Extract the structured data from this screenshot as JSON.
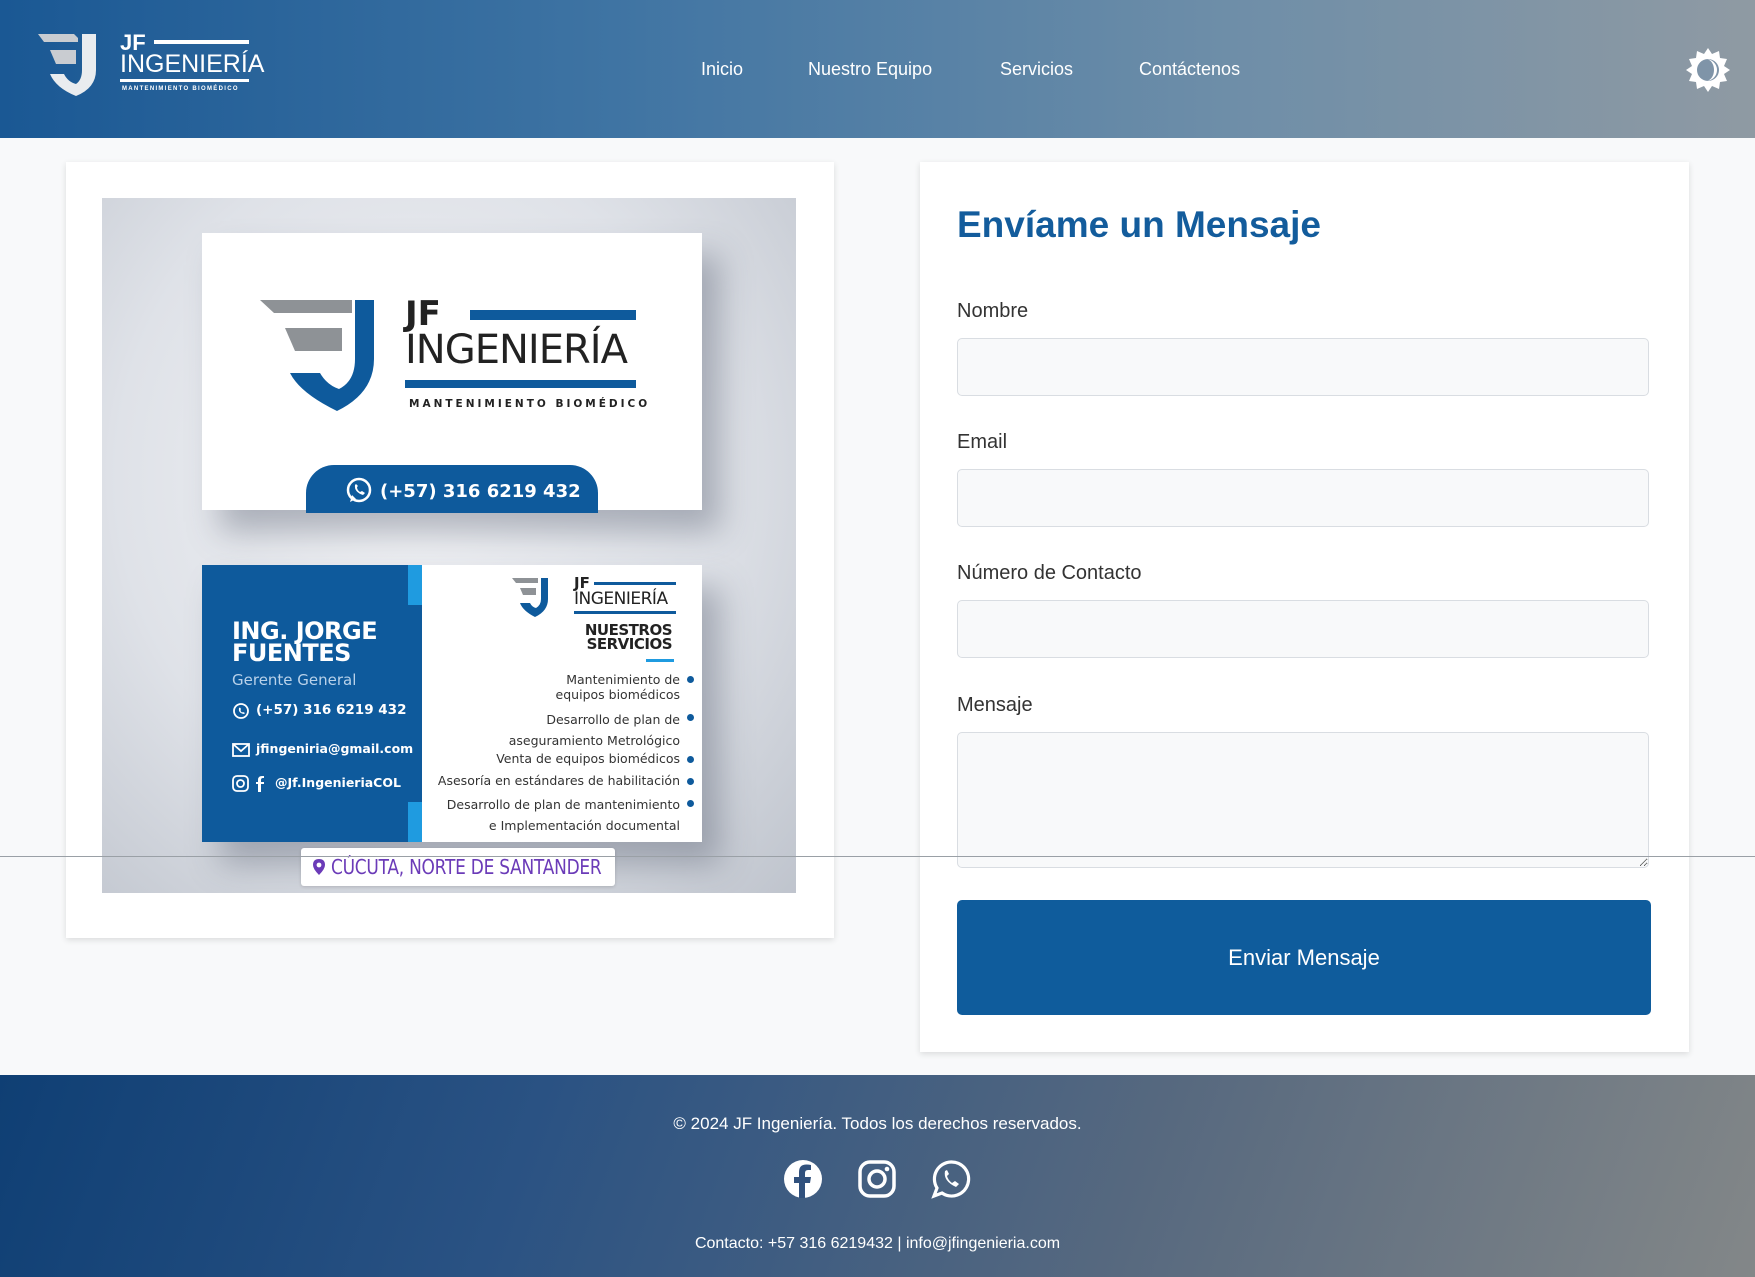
{
  "header": {
    "logo": {
      "jf": "JF",
      "name": "INGENIERÍA",
      "tagline": "MANTENIMIENTO BIOMÉDICO"
    },
    "nav": [
      {
        "label": "Inicio"
      },
      {
        "label": "Nuestro Equipo"
      },
      {
        "label": "Servicios"
      },
      {
        "label": "Contáctenos"
      }
    ],
    "theme_toggle_icon": "sun-moon-icon"
  },
  "business_card_image": {
    "front": {
      "jf": "JF",
      "name": "INGENIERÍA",
      "tagline": "MANTENIMIENTO BIOMÉDICO",
      "phone": "(+57) 316 6219 432"
    },
    "back": {
      "person_name": "ING. JORGE\nFUENTES",
      "role": "Gerente General",
      "phone": "(+57) 316 6219 432",
      "email": "jfingeniria@gmail.com",
      "social": "@Jf.IngenieriaCOL",
      "logo_jf": "JF",
      "logo_name": "INGENIERÍA",
      "services_title": "NUESTROS\nSERVICIOS",
      "services": [
        "Mantenimiento de\nequipos biomédicos",
        "Desarrollo de plan de\naseguramiento Metrológico",
        "Venta de equipos biomédicos",
        "Asesoría en estándares de habilitación",
        "Desarrollo de plan de mantenimiento\ne Implementación documental"
      ]
    },
    "location": "CÚCUTA, NORTE DE SANTANDER",
    "brand_blue": "#0e5a9c",
    "accent_light_blue": "#1f9be0"
  },
  "contact_form": {
    "title": "Envíame un Mensaje",
    "fields": {
      "name": {
        "label": "Nombre",
        "value": "",
        "placeholder": ""
      },
      "email": {
        "label": "Email",
        "value": "",
        "placeholder": ""
      },
      "phone": {
        "label": "Número de Contacto",
        "value": "",
        "placeholder": ""
      },
      "message": {
        "label": "Mensaje",
        "value": "",
        "placeholder": ""
      }
    },
    "submit_label": "Enviar Mensaje",
    "title_color": "#135c9c",
    "button_color": "#0f5c9c"
  },
  "footer": {
    "copyright": "© 2024 JF Ingeniería. Todos los derechos reservados.",
    "social": [
      {
        "icon": "facebook-icon"
      },
      {
        "icon": "instagram-icon"
      },
      {
        "icon": "whatsapp-icon"
      }
    ],
    "contact": "Contacto: +57 316 6219432 | info@jfingenieria.com"
  }
}
